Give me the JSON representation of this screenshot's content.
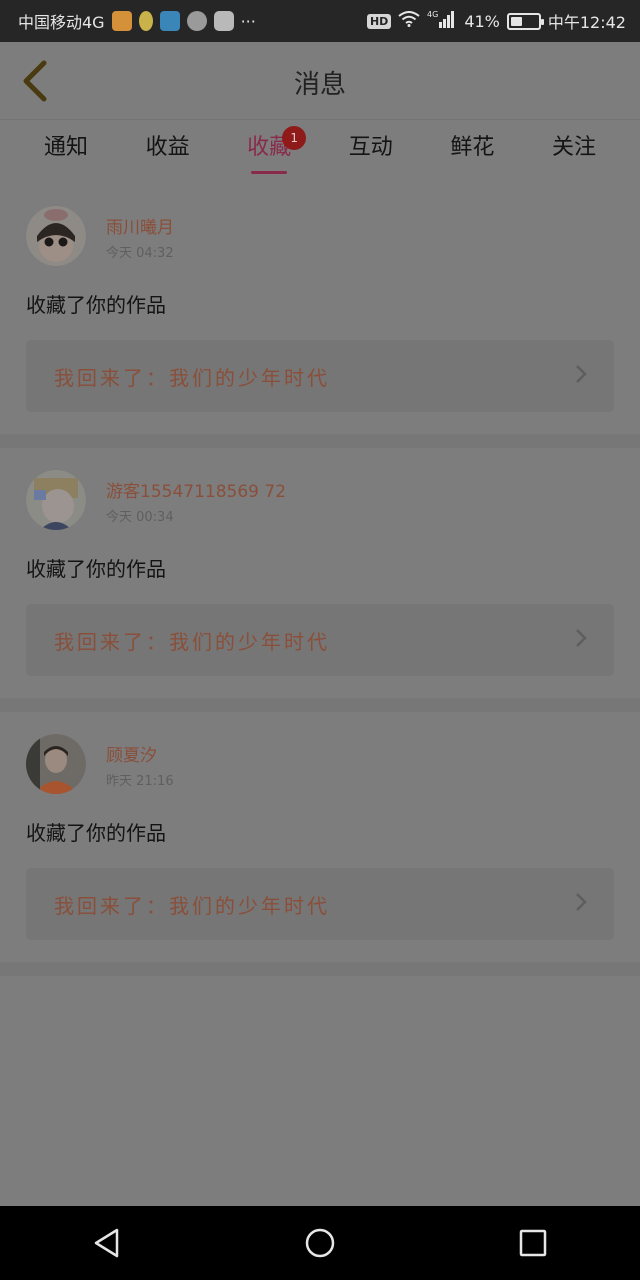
{
  "status_bar": {
    "carrier": "中国移动4G",
    "more": "···",
    "hd": "HD",
    "network": "4G",
    "battery": "41%",
    "battery_level": 0.41,
    "time": "中午12:42"
  },
  "header": {
    "title": "消息"
  },
  "tabs": [
    {
      "label": "通知",
      "active": false
    },
    {
      "label": "收益",
      "active": false
    },
    {
      "label": "收藏",
      "active": true,
      "badge": "1"
    },
    {
      "label": "互动",
      "active": false
    },
    {
      "label": "鲜花",
      "active": false
    },
    {
      "label": "关注",
      "active": false
    }
  ],
  "feed": [
    {
      "username": "雨川曦月",
      "time": "今天 04:32",
      "action": "收藏了你的作品",
      "work": "我回来了：我们的少年时代"
    },
    {
      "username": "游客15547118569 72",
      "time": "今天 00:34",
      "action": "收藏了你的作品",
      "work": "我回来了：我们的少年时代"
    },
    {
      "username": "顾夏汐",
      "time": "昨天 21:16",
      "action": "收藏了你的作品",
      "work": "我回来了：我们的少年时代"
    }
  ],
  "colors": {
    "accent": "#8a2a4a",
    "username": "#8a4f3a",
    "badge": "#8f1a1a",
    "overlay_bg": "#7d7d7d"
  }
}
